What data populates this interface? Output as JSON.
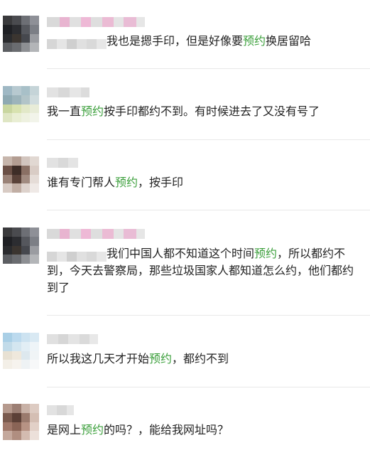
{
  "comments": [
    {
      "text_parts": [
        {
          "t": "我也是摁手印，但是好像要",
          "hl": false
        },
        {
          "t": "预约",
          "hl": true
        },
        {
          "t": "换居留哈",
          "hl": false
        }
      ]
    },
    {
      "text_parts": [
        {
          "t": "我一直",
          "hl": false
        },
        {
          "t": "预约",
          "hl": true
        },
        {
          "t": "按手印都约不到。有时候进去了又没有号了",
          "hl": false
        }
      ]
    },
    {
      "text_parts": [
        {
          "t": "谁有专门帮人",
          "hl": false
        },
        {
          "t": "预约",
          "hl": true
        },
        {
          "t": "，按手印",
          "hl": false
        }
      ]
    },
    {
      "text_parts": [
        {
          "t": "我们中国人都不知道这个时间",
          "hl": false
        },
        {
          "t": "预约",
          "hl": true
        },
        {
          "t": "，所以都约不到，今天去警察局，那些垃圾国家人都知道怎么约，他们都约到了",
          "hl": false
        }
      ]
    },
    {
      "text_parts": [
        {
          "t": "所以我这几天才开始",
          "hl": false
        },
        {
          "t": "预约",
          "hl": true
        },
        {
          "t": "，都约不到",
          "hl": false
        }
      ]
    },
    {
      "text_parts": [
        {
          "t": "是网上",
          "hl": false
        },
        {
          "t": "预约",
          "hl": true
        },
        {
          "t": "的吗？，能给我网址吗？",
          "hl": false
        }
      ]
    }
  ],
  "colors": {
    "highlight": "#3b9f3b",
    "text": "#222222",
    "divider": "#e8e8e8"
  }
}
